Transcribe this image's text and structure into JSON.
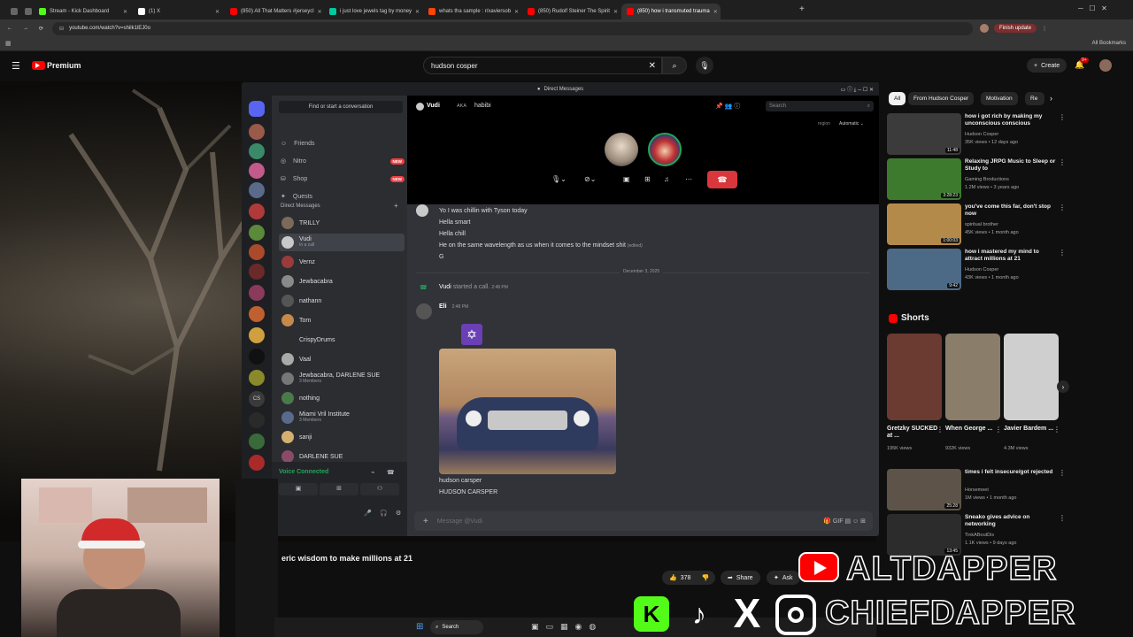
{
  "browser": {
    "tabs": [
      {
        "label": "",
        "color": "#666",
        "active": false
      },
      {
        "label": "",
        "color": "#666",
        "active": false
      },
      {
        "label": "Stream - Kick Dashboard",
        "color": "#53fc18",
        "active": false
      },
      {
        "label": "(1) X",
        "color": "#ffffff",
        "active": false
      },
      {
        "label": "(850) All That Matters #jerseycl",
        "color": "#ff0000",
        "active": false
      },
      {
        "label": "i just love jewels tag by money",
        "color": "#00c8a0",
        "active": false
      },
      {
        "label": "whats tha sample : r/xaviersob",
        "color": "#ff4500",
        "active": false
      },
      {
        "label": "(850) Rudolf Steiner The Spirit",
        "color": "#ff0000",
        "active": false
      },
      {
        "label": "(850) how i transmuted trauma",
        "color": "#ff0000",
        "active": true
      }
    ],
    "url": "youtube.com/watch?v=shilk1lEJ0o",
    "finish_update": "Finish update",
    "all_bookmarks": "All Bookmarks"
  },
  "youtube": {
    "premium": "Premium",
    "search_value": "hudson cosper",
    "create": "Create",
    "notif_count": "9+",
    "video_title": "eric wisdom to make millions at 21",
    "likes": "378",
    "share": "Share",
    "ask": "Ask",
    "chips": [
      "All",
      "From Hudson Cosper",
      "Motivation",
      "Re"
    ],
    "recommended": [
      {
        "title": "how i got rich by making my unconscious conscious",
        "channel": "Hudson Cosper",
        "meta": "35K views • 12 days ago",
        "duration": "11:48",
        "color": "#3b3b3b"
      },
      {
        "title": "Relaxing JRPG Music to Sleep or Study to",
        "channel": "Gaming Broductions",
        "meta": "1.2M views • 3 years ago",
        "duration": "3:28:23",
        "color": "#3d7a2e"
      },
      {
        "title": "you've come this far, don't stop now",
        "channel": "spiritual brother",
        "meta": "45K views • 1 month ago",
        "duration": "1:00:03",
        "color": "#b48a4a"
      },
      {
        "title": "how i mastered my mind to attract millions at 21",
        "channel": "Hudson Cosper",
        "meta": "43K views • 1 month ago",
        "duration": "9:42",
        "color": "#4c6a85"
      }
    ],
    "shorts_header": "Shorts",
    "shorts": [
      {
        "title": "Gretzky SUCKED at ...",
        "views": "195K views",
        "color": "#6b3a30"
      },
      {
        "title": "When George ...",
        "views": "932K views",
        "color": "#8a7d6a"
      },
      {
        "title": "Javier Bardem ...",
        "views": "4.3M views",
        "color": "#cfcfcf"
      }
    ],
    "recommended2": [
      {
        "title": "times i felt insecure/got rejected",
        "channel": "Horsemeet",
        "meta": "1M views • 1 month ago",
        "duration": "25:28",
        "color": "#5d5348"
      },
      {
        "title": "Sneako gives advice on networking",
        "channel": "TinkABoutDis",
        "meta": "1.1K views • 9 days ago",
        "duration": "13:45",
        "color": "#2c2c2c"
      }
    ]
  },
  "discord": {
    "window_title": "Direct Messages",
    "find_placeholder": "Find or start a conversation",
    "nav": [
      {
        "label": "Friends",
        "new": ""
      },
      {
        "label": "Nitro",
        "new": "NEW"
      },
      {
        "label": "Shop",
        "new": "NEW"
      },
      {
        "label": "Quests",
        "new": ""
      }
    ],
    "dm_header": "Direct Messages",
    "dms": [
      {
        "name": "TRILLY",
        "sub": "",
        "color": "#7b6a5a"
      },
      {
        "name": "Vudi",
        "sub": "In a call",
        "color": "#c9c9c9"
      },
      {
        "name": "Vernz",
        "sub": "",
        "color": "#9a3b3b"
      },
      {
        "name": "Jewbacabra",
        "sub": "",
        "color": "#8a8a8a"
      },
      {
        "name": "nathann",
        "sub": "",
        "color": "#555"
      },
      {
        "name": "Tom",
        "sub": "",
        "color": "#c58a4a"
      },
      {
        "name": "CrispyDrums",
        "sub": "",
        "color": "#2d2d2d"
      },
      {
        "name": "Vaal",
        "sub": "",
        "color": "#aaa"
      },
      {
        "name": "Jewbacabra, DARLENE SUE",
        "sub": "3 Members",
        "color": "#777"
      },
      {
        "name": "nothing",
        "sub": "",
        "color": "#4a7a4a"
      },
      {
        "name": "Miami Vril Institute",
        "sub": "3 Members",
        "color": "#5a6a8a"
      },
      {
        "name": "sanji",
        "sub": "",
        "color": "#d4b070"
      },
      {
        "name": "DARLENE SUE",
        "sub": "",
        "color": "#8a4a6a"
      }
    ],
    "voice_connected": "Voice Connected",
    "call_user": "Vudi",
    "aka": "AKA",
    "aka_name": "habibi",
    "search_placeholder": "Search",
    "region_label": "region",
    "region_value": "Automatic",
    "messages_top": [
      "Yo I was chillin with Tyson today",
      "Hella smart",
      "Hella chill",
      "He on the same wavelength as us when it comes to the mindset shit",
      "G"
    ],
    "edited": "(edited)",
    "date_divider": "December 3, 2025",
    "call_started_user": "Vudi",
    "call_started_text": "started a call.",
    "call_started_time": "2:48 PM",
    "eli_name": "Eli",
    "eli_time": "2:48 PM",
    "eli_msg": "",
    "caption1": "hudson carsper",
    "caption2": "HUDSON CARSPER",
    "input_placeholder": "Message @Vudi"
  },
  "taskbar": {
    "search": "Search"
  },
  "overlay": {
    "line1": "ALTDAPPER",
    "line2": "CHIEFDAPPER"
  }
}
